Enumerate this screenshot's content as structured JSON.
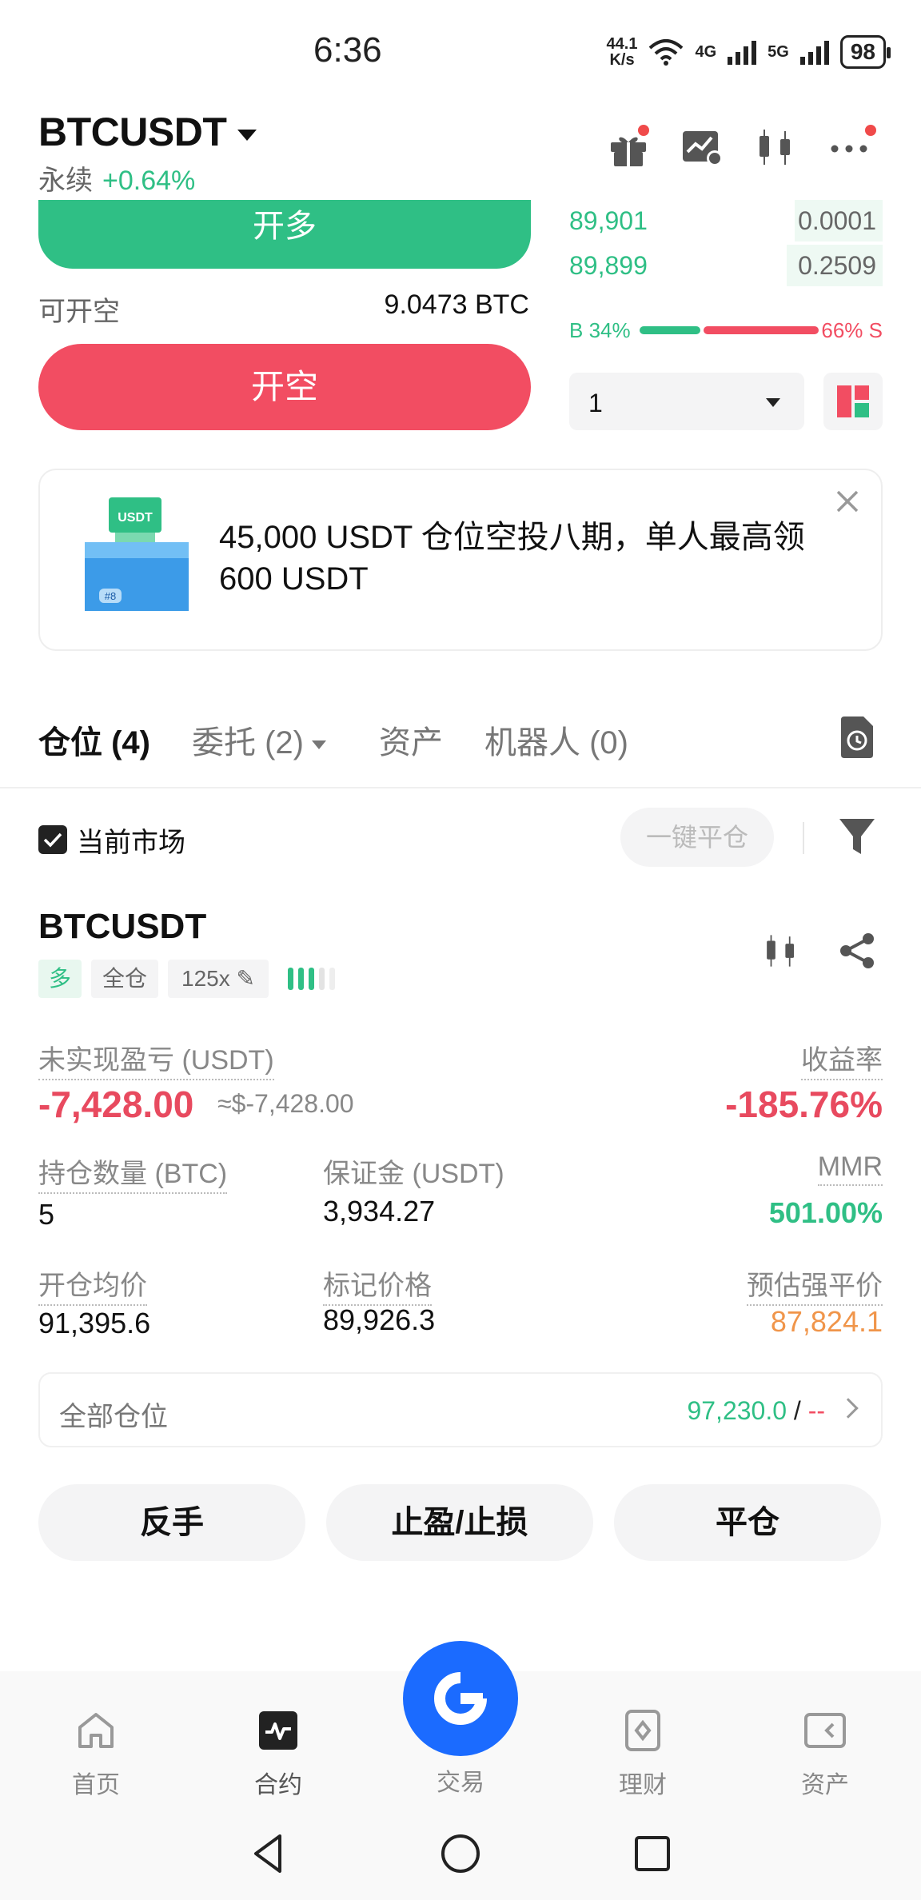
{
  "status_bar": {
    "time": "6:36",
    "net_speed_value": "44.1",
    "net_speed_unit": "K/s",
    "signal1": "4G",
    "signal2": "5G",
    "battery": "98"
  },
  "header": {
    "symbol": "BTCUSDT",
    "contract_type": "永续",
    "change": "+0.64%"
  },
  "order_panel": {
    "long_button": "开多",
    "short_avail_label": "可开空",
    "short_avail_value": "9.0473 BTC",
    "short_button": "开空"
  },
  "order_book": {
    "bids": [
      {
        "price": "89,901",
        "qty": "0.0001"
      },
      {
        "price": "89,899",
        "qty": "0.2509"
      }
    ],
    "buy_ratio": "B 34%",
    "sell_ratio": "66% S",
    "buy_pct": 34,
    "depth": "1"
  },
  "banner": {
    "text": "45,000 USDT 仓位空投八期，单人最高领 600 USDT",
    "badge": "USDT",
    "issue": "#8"
  },
  "tabs": [
    {
      "label": "仓位 (4)"
    },
    {
      "label": "委托 (2)"
    },
    {
      "label": "资产"
    },
    {
      "label": "机器人 (0)"
    }
  ],
  "filter": {
    "current_market_label": "当前市场",
    "current_market_checked": true,
    "close_all_label": "一键平仓"
  },
  "position": {
    "symbol": "BTCUSDT",
    "side_tag": "多",
    "margin_mode_tag": "全仓",
    "leverage_tag": "125x",
    "unrealized_pnl_label": "未实现盈亏 (USDT)",
    "unrealized_pnl": "-7,428.00",
    "unrealized_pnl_usd": "≈$-7,428.00",
    "roe_label": "收益率",
    "roe": "-185.76%",
    "size_label": "持仓数量 (BTC)",
    "size": "5",
    "margin_label": "保证金 (USDT)",
    "margin": "3,934.27",
    "mmr_label": "MMR",
    "mmr": "501.00%",
    "entry_label": "开仓均价",
    "entry": "91,395.6",
    "mark_label": "标记价格",
    "mark": "89,926.3",
    "liq_label": "预估强平价",
    "liq": "87,824.1",
    "all_positions_label": "全部仓位",
    "all_positions_value": "97,230.0",
    "all_positions_sep": " / ",
    "all_positions_dash": "--"
  },
  "actions": {
    "reverse": "反手",
    "tp_sl": "止盈/止损",
    "close": "平仓"
  },
  "bottom_nav": [
    {
      "label": "首页",
      "icon": "home-icon"
    },
    {
      "label": "合约",
      "icon": "futures-icon"
    },
    {
      "label": "交易",
      "icon": "trade-icon"
    },
    {
      "label": "理财",
      "icon": "earn-icon"
    },
    {
      "label": "资产",
      "icon": "wallet-icon"
    }
  ],
  "colors": {
    "green": "#2fbf85",
    "red": "#f24d62",
    "orange": "#f0954a",
    "blue": "#1b6bff"
  }
}
